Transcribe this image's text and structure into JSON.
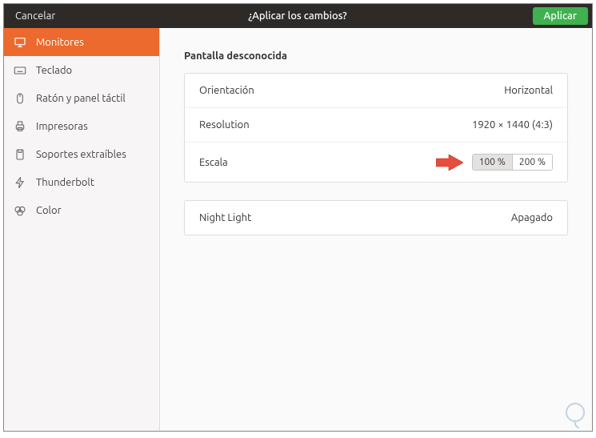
{
  "header": {
    "cancel_label": "Cancelar",
    "title": "¿Aplicar los cambios?",
    "apply_label": "Aplicar"
  },
  "sidebar": {
    "items": [
      {
        "label": "Monitores",
        "active": true
      },
      {
        "label": "Teclado",
        "active": false
      },
      {
        "label": "Ratón y panel táctil",
        "active": false
      },
      {
        "label": "Impresoras",
        "active": false
      },
      {
        "label": "Soportes extraíbles",
        "active": false
      },
      {
        "label": "Thunderbolt",
        "active": false
      },
      {
        "label": "Color",
        "active": false
      }
    ]
  },
  "main": {
    "section_title": "Pantalla desconocida",
    "rows": {
      "orientation": {
        "label": "Orientación",
        "value": "Horizontal"
      },
      "resolution": {
        "label": "Resolution",
        "value": "1920 × 1440 (4:3)"
      },
      "scale": {
        "label": "Escala",
        "options": [
          "100 %",
          "200 %"
        ],
        "selected": "100 %"
      },
      "nightlight": {
        "label": "Night Light",
        "value": "Apagado"
      }
    }
  },
  "colors": {
    "titlebar_bg": "#2e2a28",
    "apply_bg": "#3fb24f",
    "sidebar_active": "#ec6a2d"
  }
}
